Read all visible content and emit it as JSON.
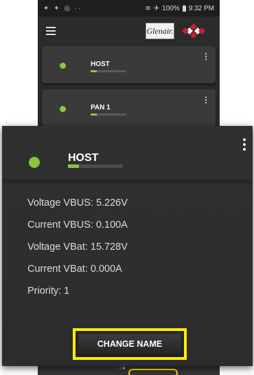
{
  "status_bar": {
    "left_icons": "✦ ✦ ◎ ··",
    "right_text": "100%",
    "time": "9:32 PM",
    "icons": [
      "wifi-icon",
      "airplane-icon",
      "battery-icon"
    ]
  },
  "app_bar": {
    "logo_text": "Glenair.",
    "menu_icon": "hamburger-icon"
  },
  "background_cards": [
    {
      "name": "HOST",
      "status_color": "#8cc63f"
    },
    {
      "name": "PAN 1",
      "status_color": "#8cc63f"
    }
  ],
  "device": {
    "name": "HOST",
    "status_color": "#8cc63f",
    "signal_level": 0.2,
    "stats": {
      "voltage_vbus": "Voltage VBUS: 5.226V",
      "current_vbus": "Current VBUS: 0.100A",
      "voltage_vbat": "Voltage VBat: 15.728V",
      "current_vbat": "Current VBat: 0.000A",
      "priority": "Priority: 1"
    },
    "action": "CHANGE NAME"
  },
  "colors": {
    "accent_green": "#8cc63f",
    "highlight_yellow": "#ffee00"
  }
}
